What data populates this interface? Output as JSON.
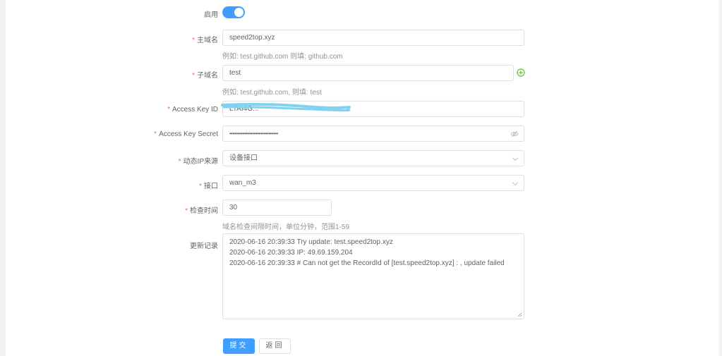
{
  "form": {
    "enable": {
      "label": "启用",
      "checked": true
    },
    "main_domain": {
      "label": "主域名",
      "value": "speed2top.xyz",
      "hint": "例如: test.github.com 则填: github.com"
    },
    "sub_domain": {
      "label": "子域名",
      "value": "test",
      "hint": "例如: test.github.com, 则填: test"
    },
    "access_key_id": {
      "label": "Access Key ID",
      "value": "LTAI4G..."
    },
    "access_key_secret": {
      "label": "Access Key Secret",
      "value": "••••••••••••••••••••••••••••••"
    },
    "ip_source": {
      "label": "动态IP来源",
      "value": "设备接口"
    },
    "interface": {
      "label": "接口",
      "value": "wan_m3"
    },
    "check_interval": {
      "label": "检查时间",
      "value": "30",
      "hint": "域名检查间隔时间，单位分钟，范围1-59"
    },
    "update_log": {
      "label": "更新记录",
      "lines": [
        "2020-06-16 20:39:33 Try update: test.speed2top.xyz",
        "2020-06-16 20:39:33 IP: 49.69.159.204",
        "2020-06-16 20:39:33 # Can not get the RecordId of [test.speed2top.xyz] : , update failed"
      ]
    }
  },
  "buttons": {
    "submit": "提交",
    "back": "返回"
  },
  "colors": {
    "primary": "#409eff",
    "required": "#f56c6c",
    "add_icon": "#67c23a",
    "scribble": "#7fd3f0"
  }
}
